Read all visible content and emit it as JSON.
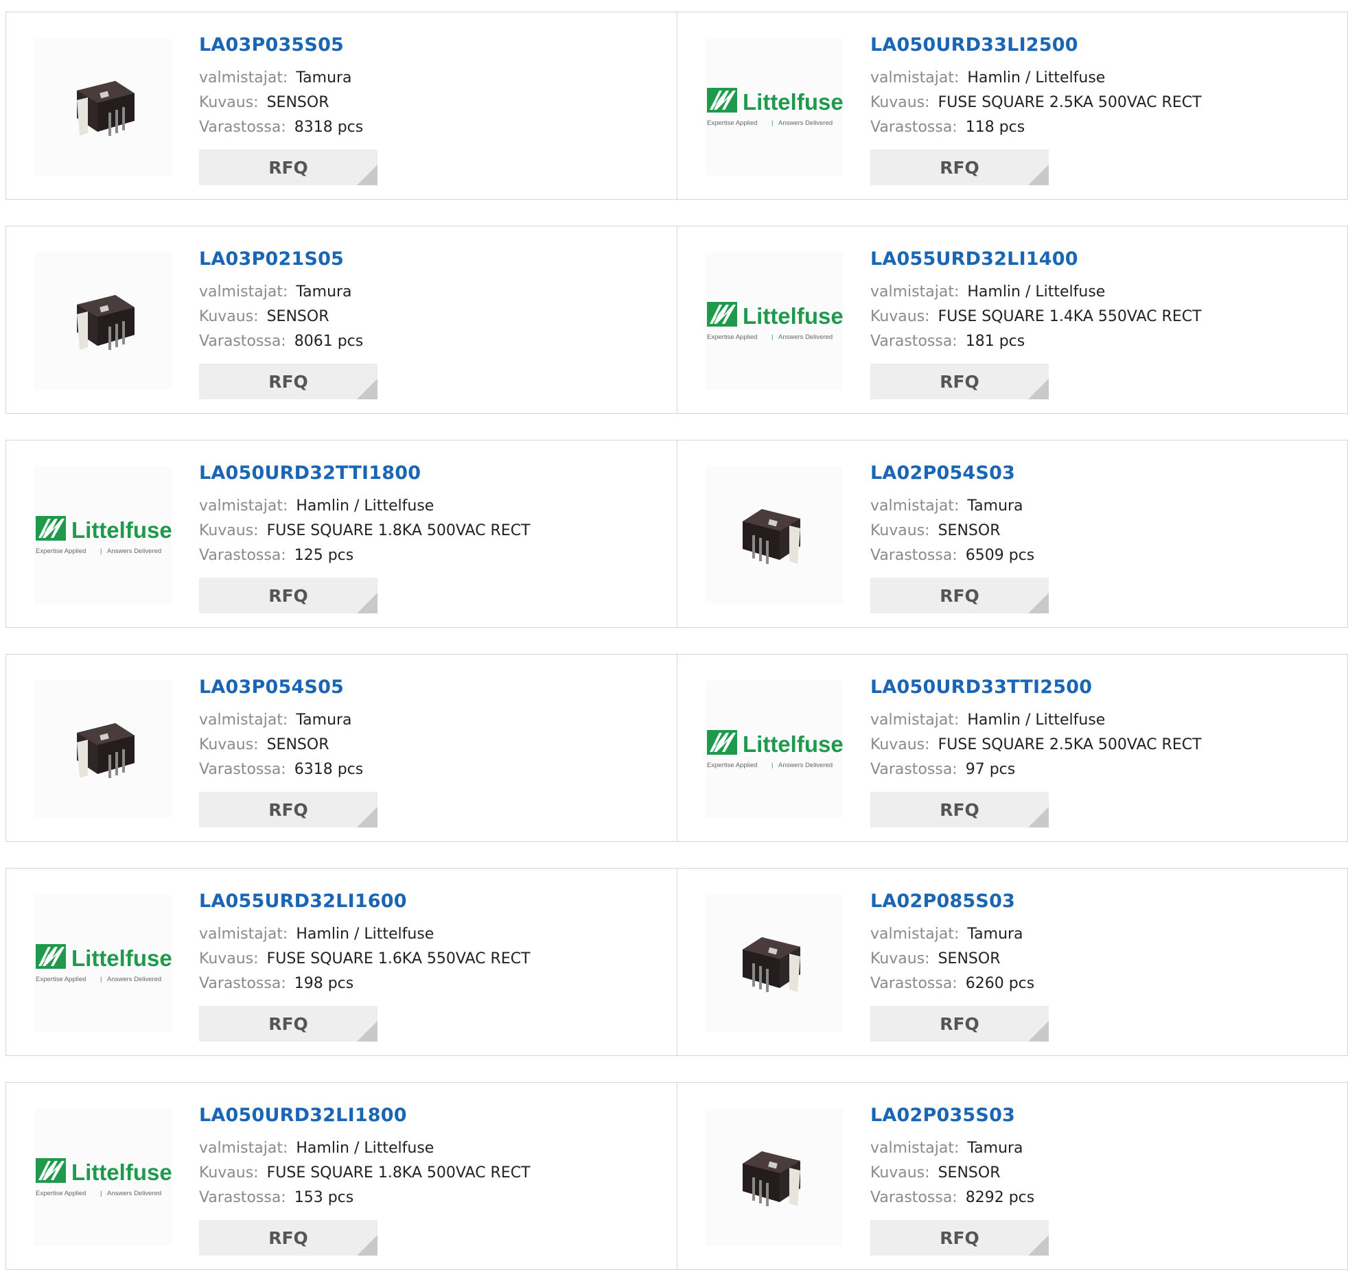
{
  "labels": {
    "manufacturer": "valmistajat:",
    "description": "Kuvaus:",
    "stock": "Varastossa:",
    "rfq": "RFQ"
  },
  "logo": {
    "brand": "Littelfuse",
    "tagline_left": "Expertise Applied",
    "tagline_right": "Answers Delivered"
  },
  "colors": {
    "link": "#1a66b4",
    "label": "#8a8a8a",
    "button_bg": "#eeeeee",
    "logo_green": "#1f9a4c"
  },
  "products": [
    [
      {
        "part": "LA03P035S05",
        "manufacturer": "Tamura",
        "description": "SENSOR",
        "stock": "8318 pcs",
        "image": "tamura-sensor-icon"
      },
      {
        "part": "LA050URD33LI2500",
        "manufacturer": "Hamlin / Littelfuse",
        "description": "FUSE SQUARE 2.5KA 500VAC RECT",
        "stock": "118 pcs",
        "image": "littelfuse-logo-icon"
      }
    ],
    [
      {
        "part": "LA03P021S05",
        "manufacturer": "Tamura",
        "description": "SENSOR",
        "stock": "8061 pcs",
        "image": "tamura-sensor-icon"
      },
      {
        "part": "LA055URD32LI1400",
        "manufacturer": "Hamlin / Littelfuse",
        "description": "FUSE SQUARE 1.4KA 550VAC RECT",
        "stock": "181 pcs",
        "image": "littelfuse-logo-icon"
      }
    ],
    [
      {
        "part": "LA050URD32TTI1800",
        "manufacturer": "Hamlin / Littelfuse",
        "description": "FUSE SQUARE 1.8KA 500VAC RECT",
        "stock": "125 pcs",
        "image": "littelfuse-logo-icon"
      },
      {
        "part": "LA02P054S03",
        "manufacturer": "Tamura",
        "description": "SENSOR",
        "stock": "6509 pcs",
        "image": "tamura-sensor-icon"
      }
    ],
    [
      {
        "part": "LA03P054S05",
        "manufacturer": "Tamura",
        "description": "SENSOR",
        "stock": "6318 pcs",
        "image": "tamura-sensor-icon"
      },
      {
        "part": "LA050URD33TTI2500",
        "manufacturer": "Hamlin / Littelfuse",
        "description": "FUSE SQUARE 2.5KA 500VAC RECT",
        "stock": "97 pcs",
        "image": "littelfuse-logo-icon"
      }
    ],
    [
      {
        "part": "LA055URD32LI1600",
        "manufacturer": "Hamlin / Littelfuse",
        "description": "FUSE SQUARE 1.6KA 550VAC RECT",
        "stock": "198 pcs",
        "image": "littelfuse-logo-icon"
      },
      {
        "part": "LA02P085S03",
        "manufacturer": "Tamura",
        "description": "SENSOR",
        "stock": "6260 pcs",
        "image": "tamura-sensor-icon"
      }
    ],
    [
      {
        "part": "LA050URD32LI1800",
        "manufacturer": "Hamlin / Littelfuse",
        "description": "FUSE SQUARE 1.8KA 500VAC RECT",
        "stock": "153 pcs",
        "image": "littelfuse-logo-icon"
      },
      {
        "part": "LA02P035S03",
        "manufacturer": "Tamura",
        "description": "SENSOR",
        "stock": "8292 pcs",
        "image": "tamura-sensor-icon"
      }
    ]
  ]
}
